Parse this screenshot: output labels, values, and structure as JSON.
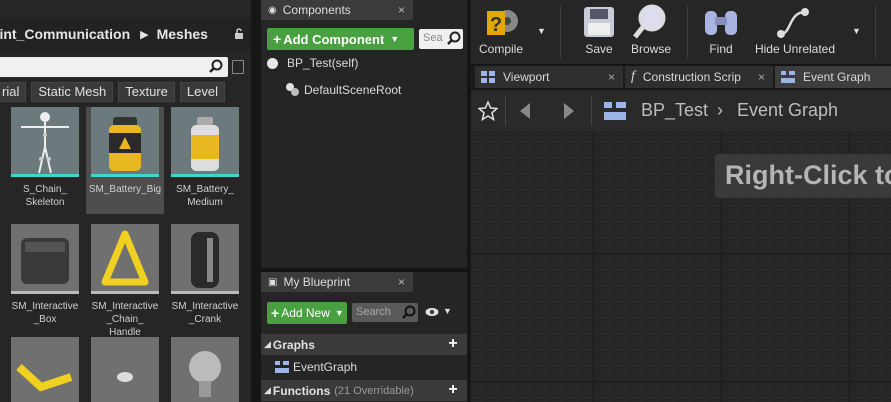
{
  "content_browser": {
    "path_segment": "rint_Communication",
    "path_folder": "Meshes",
    "filters": [
      "rial",
      "Static Mesh",
      "Texture",
      "Level"
    ],
    "assets": [
      {
        "label": "S_Chain_\nSkeleton"
      },
      {
        "label": "SM_Battery_Big"
      },
      {
        "label": "SM_Battery_\nMedium"
      },
      {
        "label": "SM_Interactive\n_Box"
      },
      {
        "label": "SM_Interactive\n_Chain_\nHandle"
      },
      {
        "label": "SM_Interactive\n_Crank"
      }
    ]
  },
  "components": {
    "title": "Components",
    "add_label": "Add Component",
    "search_placeholder": "Sea",
    "self_label": "BP_Test(self)",
    "root_label": "DefaultSceneRoot"
  },
  "my_blueprint": {
    "title": "My Blueprint",
    "add_label": "Add New",
    "search_placeholder": "Search",
    "graphs_label": "Graphs",
    "graph_item": "EventGraph",
    "functions_label": "Functions",
    "functions_sub": "(21 Overridable)"
  },
  "toolbar": {
    "compile": "Compile",
    "save": "Save",
    "browse": "Browse",
    "find": "Find",
    "hide_unrelated": "Hide Unrelated"
  },
  "doc_tabs": {
    "viewport": "Viewport",
    "construction": "Construction Scrip",
    "event_graph": "Event Graph"
  },
  "breadcrumb": {
    "blueprint": "BP_Test",
    "graph": "Event Graph"
  },
  "graph_hint": "Right-Click to",
  "colors": {
    "accent_green": "#48a040",
    "asset_cyan": "#3fd6d0"
  }
}
